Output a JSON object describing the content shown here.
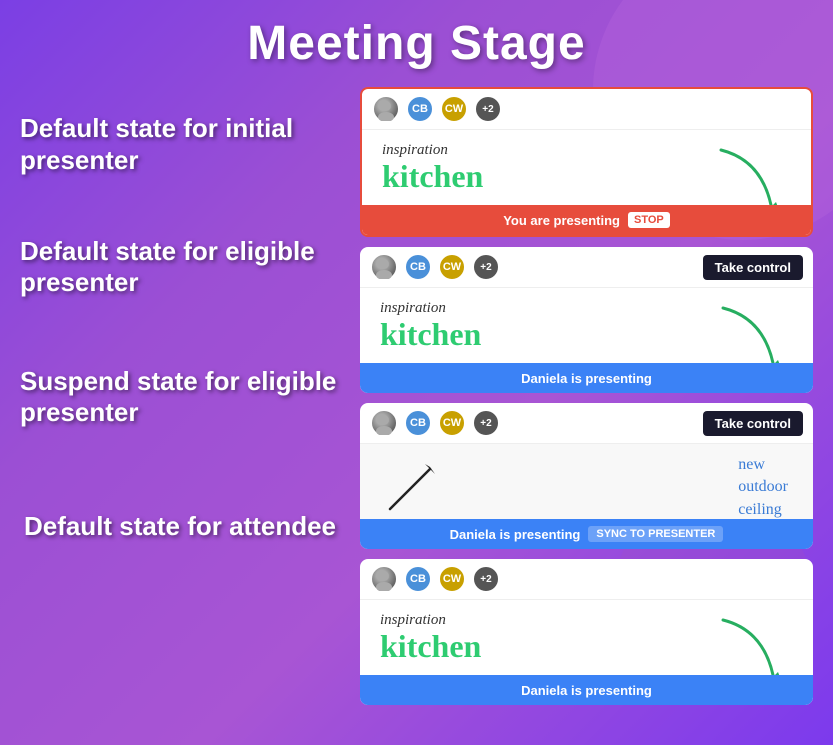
{
  "title": "Meeting Stage",
  "labels": [
    {
      "id": "label-1",
      "text": "Default state for initial presenter"
    },
    {
      "id": "label-2",
      "text": "Default state for eligible presenter"
    },
    {
      "id": "label-3",
      "text": "Suspend state for eligible presenter"
    },
    {
      "id": "label-4",
      "text": "Default state for attendee"
    }
  ],
  "panels": [
    {
      "id": "panel-1",
      "type": "initial-presenter",
      "avatars": [
        {
          "type": "img",
          "initials": ""
        },
        {
          "type": "cb",
          "initials": "CB"
        },
        {
          "type": "cw",
          "initials": "CW"
        },
        {
          "type": "plus",
          "initials": "+2"
        }
      ],
      "has_take_control": false,
      "content": {
        "inspiration": "inspiration",
        "main_text": "kitchen",
        "arrow": true
      },
      "status": {
        "text": "You are presenting",
        "type": "red",
        "action": "STOP"
      }
    },
    {
      "id": "panel-2",
      "type": "eligible-presenter",
      "avatars": [
        {
          "type": "img",
          "initials": ""
        },
        {
          "type": "cb",
          "initials": "CB"
        },
        {
          "type": "cw",
          "initials": "CW"
        },
        {
          "type": "plus",
          "initials": "+2"
        }
      ],
      "has_take_control": true,
      "take_control_label": "Take control",
      "content": {
        "inspiration": "inspiration",
        "main_text": "kitchen",
        "arrow": true
      },
      "status": {
        "text": "Daniela is presenting",
        "type": "blue",
        "action": null
      }
    },
    {
      "id": "panel-3",
      "type": "suspend-eligible",
      "avatars": [
        {
          "type": "img",
          "initials": ""
        },
        {
          "type": "cb",
          "initials": "CB"
        },
        {
          "type": "cw",
          "initials": "CW"
        },
        {
          "type": "plus",
          "initials": "+2"
        }
      ],
      "has_take_control": true,
      "take_control_label": "Take control",
      "content": {
        "handwriting": "new outdoor ceiling",
        "arrow_line": true
      },
      "status": {
        "text": "Daniela is presenting",
        "type": "blue",
        "action": "SYNC TO PRESENTER"
      }
    },
    {
      "id": "panel-4",
      "type": "attendee",
      "avatars": [
        {
          "type": "img",
          "initials": ""
        },
        {
          "type": "cb",
          "initials": "CB"
        },
        {
          "type": "cw",
          "initials": "CW"
        },
        {
          "type": "plus",
          "initials": "+2"
        }
      ],
      "has_take_control": false,
      "content": {
        "inspiration": "inspiration",
        "main_text": "kitchen",
        "arrow": true
      },
      "status": {
        "text": "Daniela is presenting",
        "type": "blue",
        "action": null
      }
    }
  ]
}
